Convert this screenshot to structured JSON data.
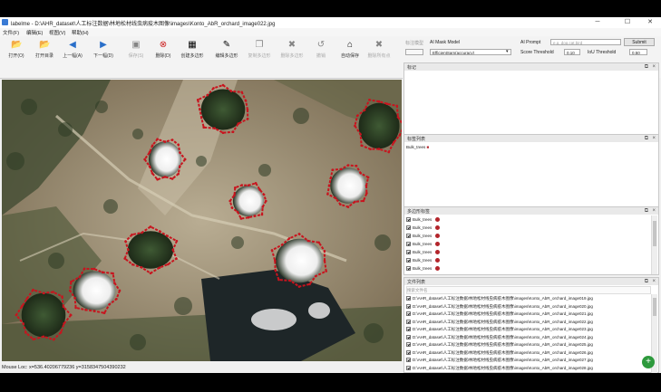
{
  "window": {
    "title": "labelme - D:\\AHR_dataset\\人工标注数据\\林地松材线虫病疫木图像\\images\\Konto_AbR_orchard_image022.jpg",
    "min_glyph": "─",
    "max_glyph": "☐",
    "close_glyph": "✕"
  },
  "menu": [
    "文件(F)",
    "编辑(E)",
    "视图(V)",
    "帮助(H)"
  ],
  "toolbar": [
    {
      "label": "打开(O)",
      "icon": "open-folder-icon",
      "glyph": "📂",
      "disabled": false
    },
    {
      "label": "打开目录",
      "icon": "open-dir-icon",
      "glyph": "📂",
      "disabled": false
    },
    {
      "label": "上一幅(A)",
      "icon": "prev-arrow-icon",
      "glyph": "◀",
      "color": "#2a6fc9",
      "disabled": false
    },
    {
      "label": "下一幅(D)",
      "icon": "next-arrow-icon",
      "glyph": "▶",
      "color": "#2a6fc9",
      "disabled": false
    },
    {
      "label": "保存(S)",
      "icon": "save-icon",
      "glyph": "▣",
      "disabled": true
    },
    {
      "label": "删除(D)",
      "icon": "delete-file-icon",
      "glyph": "⊗",
      "color": "#cc2222",
      "disabled": false
    },
    {
      "label": "创建多边形",
      "icon": "create-polygon-icon",
      "glyph": "▦",
      "disabled": false
    },
    {
      "label": "编辑多边形",
      "icon": "edit-polygon-icon",
      "glyph": "✎",
      "disabled": false
    },
    {
      "label": "复制多边形",
      "icon": "copy-polygon-icon",
      "glyph": "❐",
      "disabled": true
    },
    {
      "label": "删除多边形",
      "icon": "delete-polygon-icon",
      "glyph": "✖",
      "disabled": true
    },
    {
      "label": "撤销",
      "icon": "undo-icon",
      "glyph": "↺",
      "disabled": true
    },
    {
      "label": "自动保存",
      "icon": "autosave-icon",
      "glyph": "⌂",
      "disabled": false
    },
    {
      "label": "删除所有点",
      "icon": "clear-points-icon",
      "glyph": "✖",
      "disabled": true
    }
  ],
  "ai": {
    "mask_label": "标注模型",
    "model_label": "AI Mask Model",
    "model_value": "EfficientSam(accuracy)",
    "prompt_label": "AI Prompt",
    "prompt_placeholder": "e.g. dog,cat,bird",
    "submit": "Submit",
    "score_label": "Score Threshold",
    "score_value": "0.10",
    "iou_label": "IoU Threshold",
    "iou_value": "0.50"
  },
  "panels": {
    "flags": {
      "title": "标记"
    },
    "label_list": {
      "title": "标签列表",
      "items": [
        {
          "label": "Bulk_trees",
          "mark": "■"
        }
      ]
    },
    "polygon_labels": {
      "title": "多边形标签",
      "items": [
        {
          "label": "Bulk_trees"
        },
        {
          "label": "Bulk_trees"
        },
        {
          "label": "Bulk_trees"
        },
        {
          "label": "Bulk_trees"
        },
        {
          "label": "Bulk_trees"
        },
        {
          "label": "Bulk_trees"
        },
        {
          "label": "Bulk_trees"
        }
      ]
    },
    "file_list": {
      "title": "文件列表",
      "search_placeholder": "搜索文件名",
      "files": [
        {
          "name": "D:\\AHR_dataset\\人工标注数据\\林地松材线虫病疫木图像\\images\\Konto_AbR_orchard_image019.jpg"
        },
        {
          "name": "D:\\AHR_dataset\\人工标注数据\\林地松材线虫病疫木图像\\images\\Konto_AbR_orchard_image020.jpg"
        },
        {
          "name": "D:\\AHR_dataset\\人工标注数据\\林地松材线虫病疫木图像\\images\\Konto_AbR_orchard_image021.jpg"
        },
        {
          "name": "D:\\AHR_dataset\\人工标注数据\\林地松材线虫病疫木图像\\images\\Konto_AbR_orchard_image022.jpg"
        },
        {
          "name": "D:\\AHR_dataset\\人工标注数据\\林地松材线虫病疫木图像\\images\\Konto_AbR_orchard_image023.jpg"
        },
        {
          "name": "D:\\AHR_dataset\\人工标注数据\\林地松材线虫病疫木图像\\images\\Konto_AbR_orchard_image024.jpg"
        },
        {
          "name": "D:\\AHR_dataset\\人工标注数据\\林地松材线虫病疫木图像\\images\\Konto_AbR_orchard_image025.jpg"
        },
        {
          "name": "D:\\AHR_dataset\\人工标注数据\\林地松材线虫病疫木图像\\images\\Konto_AbR_orchard_image026.jpg"
        },
        {
          "name": "D:\\AHR_dataset\\人工标注数据\\林地松材线虫病疫木图像\\images\\Konto_AbR_orchard_image027.jpg"
        },
        {
          "name": "D:\\AHR_dataset\\人工标注数据\\林地松材线虫病疫木图像\\images\\Konto_AbR_orchard_image028.jpg"
        }
      ]
    }
  },
  "canvas": {
    "polygon_color": "#c8141e",
    "vertex_color": "#c8141e"
  },
  "status": {
    "text": "Mouse Loc: x=536.40206779236 y=3158347504390232"
  },
  "fab": {
    "glyph": "+"
  }
}
